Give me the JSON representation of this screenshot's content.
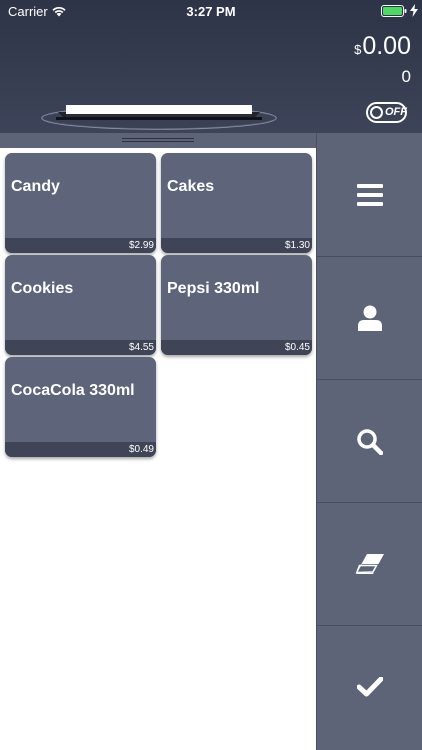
{
  "status_bar": {
    "carrier": "Carrier",
    "time": "3:27 PM",
    "battery_color": "#4cd964"
  },
  "header": {
    "currency_symbol": "$",
    "total": "0.00",
    "item_count": "0",
    "toggle_label": "OFF"
  },
  "products": [
    {
      "name": "Candy",
      "price": "$2.99"
    },
    {
      "name": "Cakes",
      "price": "$1.30"
    },
    {
      "name": "Cookies",
      "price": "$4.55"
    },
    {
      "name": "Pepsi 330ml",
      "price": "$0.45"
    },
    {
      "name": "CocaCola 330ml",
      "price": "$0.49"
    }
  ],
  "sidebar": {
    "buttons": [
      {
        "icon": "menu-icon"
      },
      {
        "icon": "user-icon"
      },
      {
        "icon": "search-icon"
      },
      {
        "icon": "eraser-icon"
      },
      {
        "icon": "checkmark-icon"
      }
    ]
  },
  "colors": {
    "header_bg": "#343a4e",
    "tile_bg": "#5e6479",
    "sidebar_bg": "#5d6478"
  }
}
